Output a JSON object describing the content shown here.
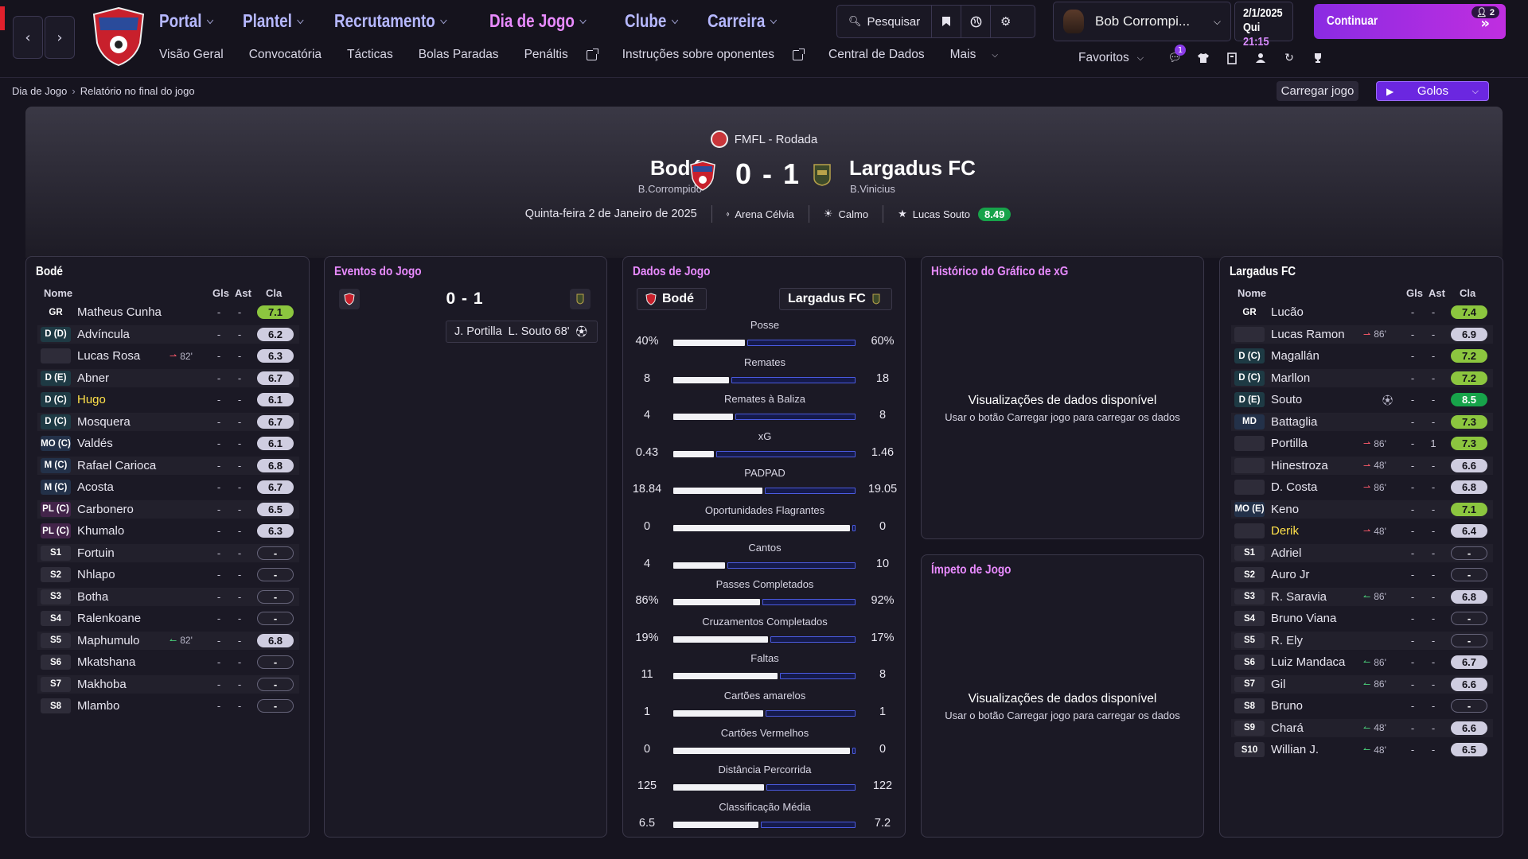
{
  "nav": {
    "main": [
      {
        "label": "Portal",
        "active": false
      },
      {
        "label": "Plantel",
        "active": false
      },
      {
        "label": "Recrutamento",
        "active": false
      },
      {
        "label": "Dia de Jogo",
        "active": true
      },
      {
        "label": "Clube",
        "active": false
      },
      {
        "label": "Carreira",
        "active": false
      }
    ],
    "sub": [
      "Visão Geral",
      "Convocatória",
      "Tácticas",
      "Bolas Paradas",
      "Penáltis",
      "Instruções sobre oponentes",
      "Central de Dados",
      "Mais"
    ],
    "search_label": "Pesquisar",
    "user_name": "Bob Corrompi...",
    "date": "2/1/2025",
    "day": "Qui",
    "time": "21:15",
    "continue_label": "Continuar",
    "continue_badge": "2",
    "favorites_label": "Favoritos",
    "notif_count": "1"
  },
  "breadcrumb": {
    "parent": "Dia de Jogo",
    "current": "Relatório no final do jogo"
  },
  "actions": {
    "load_game": "Carregar jogo",
    "goals": "Golos"
  },
  "match": {
    "competition": "FMFL - Rodada",
    "home": "Bodé",
    "home_manager": "B.Corrompido",
    "score": "0 - 1",
    "away": "Largadus FC",
    "away_manager": "B.Vinicius",
    "date": "Quinta-feira 2 de Janeiro de 2025",
    "stadium": "Arena Célvia",
    "weather": "Calmo",
    "motm": "Lucas Souto",
    "motm_rating": "8.49"
  },
  "home_panel": {
    "title": "Bodé",
    "headers": {
      "name": "Nome",
      "gls": "Gls",
      "ast": "Ast",
      "cla": "Cla"
    },
    "players": [
      {
        "pos": "GR",
        "name": "Matheus Cunha",
        "sub": "",
        "dir": "",
        "gls": "-",
        "ast": "-",
        "rating": "7.1",
        "rc": "g"
      },
      {
        "pos": "D (D)",
        "name": "Advíncula",
        "sub": "",
        "dir": "",
        "gls": "-",
        "ast": "-",
        "rating": "6.2",
        "rc": "n"
      },
      {
        "pos": "",
        "name": "Lucas Rosa",
        "sub": "82'",
        "dir": "out",
        "gls": "-",
        "ast": "-",
        "rating": "6.3",
        "rc": "n"
      },
      {
        "pos": "D (E)",
        "name": "Abner",
        "sub": "",
        "dir": "",
        "gls": "-",
        "ast": "-",
        "rating": "6.7",
        "rc": "n"
      },
      {
        "pos": "D (C)",
        "name": "Hugo",
        "sub": "",
        "dir": "",
        "gls": "-",
        "ast": "-",
        "rating": "6.1",
        "rc": "n",
        "hl": true
      },
      {
        "pos": "D (C)",
        "name": "Mosquera",
        "sub": "",
        "dir": "",
        "gls": "-",
        "ast": "-",
        "rating": "6.7",
        "rc": "n"
      },
      {
        "pos": "MO (C)",
        "name": "Valdés",
        "sub": "",
        "dir": "",
        "gls": "-",
        "ast": "-",
        "rating": "6.1",
        "rc": "n"
      },
      {
        "pos": "M (C)",
        "name": "Rafael Carioca",
        "sub": "",
        "dir": "",
        "gls": "-",
        "ast": "-",
        "rating": "6.8",
        "rc": "n"
      },
      {
        "pos": "M (C)",
        "name": "Acosta",
        "sub": "",
        "dir": "",
        "gls": "-",
        "ast": "-",
        "rating": "6.7",
        "rc": "n"
      },
      {
        "pos": "PL (C)",
        "name": "Carbonero",
        "sub": "",
        "dir": "",
        "gls": "-",
        "ast": "-",
        "rating": "6.5",
        "rc": "n"
      },
      {
        "pos": "PL (C)",
        "name": "Khumalo",
        "sub": "",
        "dir": "",
        "gls": "-",
        "ast": "-",
        "rating": "6.3",
        "rc": "n"
      },
      {
        "pos": "S1",
        "name": "Fortuin",
        "sub": "",
        "dir": "",
        "gls": "-",
        "ast": "-",
        "rating": "-",
        "rc": "empty"
      },
      {
        "pos": "S2",
        "name": "Nhlapo",
        "sub": "",
        "dir": "",
        "gls": "-",
        "ast": "-",
        "rating": "-",
        "rc": "empty"
      },
      {
        "pos": "S3",
        "name": "Botha",
        "sub": "",
        "dir": "",
        "gls": "-",
        "ast": "-",
        "rating": "-",
        "rc": "empty"
      },
      {
        "pos": "S4",
        "name": "Ralenkoane",
        "sub": "",
        "dir": "",
        "gls": "-",
        "ast": "-",
        "rating": "-",
        "rc": "empty"
      },
      {
        "pos": "S5",
        "name": "Maphumulo",
        "sub": "82'",
        "dir": "in",
        "gls": "-",
        "ast": "-",
        "rating": "6.8",
        "rc": "n"
      },
      {
        "pos": "S6",
        "name": "Mkatshana",
        "sub": "",
        "dir": "",
        "gls": "-",
        "ast": "-",
        "rating": "-",
        "rc": "empty"
      },
      {
        "pos": "S7",
        "name": "Makhoba",
        "sub": "",
        "dir": "",
        "gls": "-",
        "ast": "-",
        "rating": "-",
        "rc": "empty"
      },
      {
        "pos": "S8",
        "name": "Mlambo",
        "sub": "",
        "dir": "",
        "gls": "-",
        "ast": "-",
        "rating": "-",
        "rc": "empty"
      }
    ]
  },
  "away_panel": {
    "title": "Largadus FC",
    "headers": {
      "name": "Nome",
      "gls": "Gls",
      "ast": "Ast",
      "cla": "Cla"
    },
    "players": [
      {
        "pos": "GR",
        "name": "Lucão",
        "sub": "",
        "dir": "",
        "gls": "-",
        "ast": "-",
        "rating": "7.4",
        "rc": "g"
      },
      {
        "pos": "",
        "name": "Lucas Ramon",
        "sub": "86'",
        "dir": "out",
        "gls": "-",
        "ast": "-",
        "rating": "6.9",
        "rc": "n"
      },
      {
        "pos": "D (C)",
        "name": "Magallán",
        "sub": "",
        "dir": "",
        "gls": "-",
        "ast": "-",
        "rating": "7.2",
        "rc": "g"
      },
      {
        "pos": "D (C)",
        "name": "Marllon",
        "sub": "",
        "dir": "",
        "gls": "-",
        "ast": "-",
        "rating": "7.2",
        "rc": "g"
      },
      {
        "pos": "D (E)",
        "name": "Souto",
        "sub": "",
        "dir": "goal",
        "gls": "-",
        "ast": "-",
        "rating": "8.5",
        "rc": "gg"
      },
      {
        "pos": "MD",
        "name": "Battaglia",
        "sub": "",
        "dir": "",
        "gls": "-",
        "ast": "-",
        "rating": "7.3",
        "rc": "g"
      },
      {
        "pos": "",
        "name": "Portilla",
        "sub": "86'",
        "dir": "out",
        "gls": "-",
        "ast": "1",
        "rating": "7.3",
        "rc": "g"
      },
      {
        "pos": "",
        "name": "Hinestroza",
        "sub": "48'",
        "dir": "out",
        "gls": "-",
        "ast": "-",
        "rating": "6.6",
        "rc": "n"
      },
      {
        "pos": "",
        "name": "D. Costa",
        "sub": "86'",
        "dir": "out",
        "gls": "-",
        "ast": "-",
        "rating": "6.8",
        "rc": "n"
      },
      {
        "pos": "MO (E)",
        "name": "Keno",
        "sub": "",
        "dir": "",
        "gls": "-",
        "ast": "-",
        "rating": "7.1",
        "rc": "g"
      },
      {
        "pos": "",
        "name": "Derik",
        "sub": "48'",
        "dir": "out",
        "gls": "-",
        "ast": "-",
        "rating": "6.4",
        "rc": "n",
        "hl": true
      },
      {
        "pos": "S1",
        "name": "Adriel",
        "sub": "",
        "dir": "",
        "gls": "-",
        "ast": "-",
        "rating": "-",
        "rc": "empty"
      },
      {
        "pos": "S2",
        "name": "Auro Jr",
        "sub": "",
        "dir": "",
        "gls": "-",
        "ast": "-",
        "rating": "-",
        "rc": "empty"
      },
      {
        "pos": "S3",
        "name": "R. Saravia",
        "sub": "86'",
        "dir": "in",
        "gls": "-",
        "ast": "-",
        "rating": "6.8",
        "rc": "n"
      },
      {
        "pos": "S4",
        "name": "Bruno Viana",
        "sub": "",
        "dir": "",
        "gls": "-",
        "ast": "-",
        "rating": "-",
        "rc": "empty"
      },
      {
        "pos": "S5",
        "name": "R. Ely",
        "sub": "",
        "dir": "",
        "gls": "-",
        "ast": "-",
        "rating": "-",
        "rc": "empty"
      },
      {
        "pos": "S6",
        "name": "Luiz Mandaca",
        "sub": "86'",
        "dir": "in",
        "gls": "-",
        "ast": "-",
        "rating": "6.7",
        "rc": "n"
      },
      {
        "pos": "S7",
        "name": "Gil",
        "sub": "86'",
        "dir": "in",
        "gls": "-",
        "ast": "-",
        "rating": "6.6",
        "rc": "n"
      },
      {
        "pos": "S8",
        "name": "Bruno",
        "sub": "",
        "dir": "",
        "gls": "-",
        "ast": "-",
        "rating": "-",
        "rc": "empty"
      },
      {
        "pos": "S9",
        "name": "Chará",
        "sub": "48'",
        "dir": "in",
        "gls": "-",
        "ast": "-",
        "rating": "6.6",
        "rc": "n"
      },
      {
        "pos": "S10",
        "name": "Willian J.",
        "sub": "48'",
        "dir": "in",
        "gls": "-",
        "ast": "-",
        "rating": "6.5",
        "rc": "n"
      }
    ]
  },
  "events": {
    "title": "Eventos do Jogo",
    "score": "0 - 1",
    "goal": {
      "assist": "J. Portilla",
      "scorer": "L. Souto 68'"
    }
  },
  "stats": {
    "title": "Dados de Jogo",
    "home": "Bodé",
    "away": "Largadus FC",
    "rows": [
      {
        "label": "Posse",
        "home": "40%",
        "away": "60%",
        "h": 40,
        "a": 60
      },
      {
        "label": "Remates",
        "home": "8",
        "away": "18",
        "h": 8,
        "a": 18
      },
      {
        "label": "Remates à Baliza",
        "home": "4",
        "away": "8",
        "h": 4,
        "a": 8
      },
      {
        "label": "xG",
        "home": "0.43",
        "away": "1.46",
        "h": 0.43,
        "a": 1.46
      },
      {
        "label": "PADPAD",
        "home": "18.84",
        "away": "19.05",
        "h": 18.84,
        "a": 19.05
      },
      {
        "label": "Oportunidades Flagrantes",
        "home": "0",
        "away": "0",
        "h": 0,
        "a": 0
      },
      {
        "label": "Cantos",
        "home": "4",
        "away": "10",
        "h": 4,
        "a": 10
      },
      {
        "label": "Passes Completados",
        "home": "86%",
        "away": "92%",
        "h": 86,
        "a": 92
      },
      {
        "label": "Cruzamentos Completados",
        "home": "19%",
        "away": "17%",
        "h": 19,
        "a": 17
      },
      {
        "label": "Faltas",
        "home": "11",
        "away": "8",
        "h": 11,
        "a": 8
      },
      {
        "label": "Cartões amarelos",
        "home": "1",
        "away": "1",
        "h": 1,
        "a": 1
      },
      {
        "label": "Cartões Vermelhos",
        "home": "0",
        "away": "0",
        "h": 0,
        "a": 0
      },
      {
        "label": "Distância Percorrida",
        "home": "125",
        "away": "122",
        "h": 125,
        "a": 122
      },
      {
        "label": "Classificação Média",
        "home": "6.5",
        "away": "7.2",
        "h": 6.5,
        "a": 7.2
      }
    ]
  },
  "xg_panel": {
    "title": "Histórico do Gráfico de xG",
    "empty_title": "Visualizações de dados disponível",
    "empty_hint": "Usar o botão Carregar jogo para carregar os dados"
  },
  "momentum_panel": {
    "title": "Ímpeto de Jogo",
    "empty_title": "Visualizações de dados disponível",
    "empty_hint": "Usar o botão Carregar jogo para carregar os dados"
  },
  "colors": {
    "accent": "#e98bff",
    "nav": "#b6b8ff",
    "continue": "#a22de2",
    "good": "#8cc63f",
    "best": "#17a34a"
  }
}
